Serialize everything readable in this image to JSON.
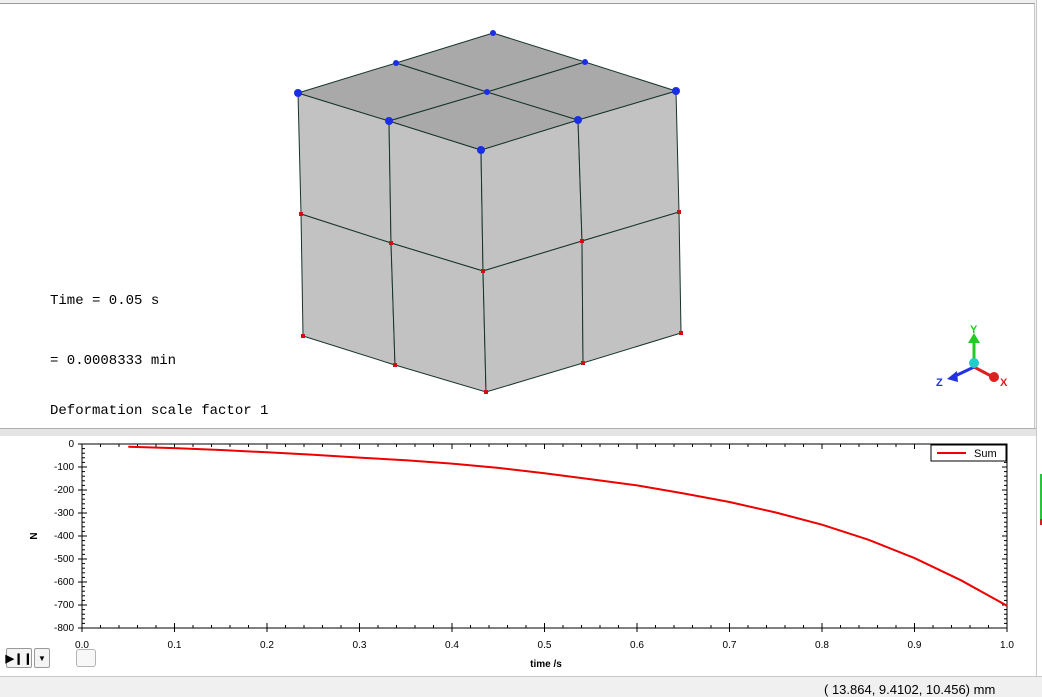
{
  "viewport": {
    "time_line1": "Time = 0.05 s",
    "time_line2": "= 0.0008333 min",
    "deformation_label": "Deformation scale factor 1",
    "axes": {
      "y": "Y",
      "z": "Z",
      "x": "X"
    },
    "colors": {
      "face_top": "#a9a9a9",
      "face_side": "#c2c2c2",
      "node_top": "#1a2ee6",
      "node_side": "#d01010",
      "axis_x": "#dd2020",
      "axis_y": "#22cc22",
      "axis_z": "#2233dd"
    }
  },
  "chart_data": {
    "type": "line",
    "title": "",
    "xlabel": "time /s",
    "ylabel": "N",
    "xlim": [
      0.0,
      1.0
    ],
    "ylim": [
      -800,
      0
    ],
    "xticks": [
      0.0,
      0.1,
      0.2,
      0.3,
      0.4,
      0.5,
      0.6,
      0.7,
      0.8,
      0.9,
      1.0
    ],
    "xtick_labels": [
      "0.0",
      "0.1",
      "0.2",
      "0.3",
      "0.4",
      "0.5",
      "0.6",
      "0.7",
      "0.8",
      "0.9",
      "1.0"
    ],
    "yticks": [
      0,
      -100,
      -200,
      -300,
      -400,
      -500,
      -600,
      -700,
      -800
    ],
    "ytick_labels": [
      "0",
      "-100",
      "-200",
      "-300",
      "-400",
      "-500",
      "-600",
      "-700",
      "-800"
    ],
    "legend": "top-right",
    "grid": false,
    "series": [
      {
        "name": "Sum",
        "color": "#ee0000",
        "x": [
          0.05,
          0.1,
          0.15,
          0.2,
          0.25,
          0.3,
          0.35,
          0.4,
          0.45,
          0.5,
          0.55,
          0.6,
          0.65,
          0.7,
          0.75,
          0.8,
          0.85,
          0.9,
          0.95,
          1.0
        ],
        "y": [
          -12,
          -18,
          -26,
          -36,
          -47,
          -59,
          -71,
          -85,
          -104,
          -127,
          -153,
          -180,
          -215,
          -252,
          -298,
          -351,
          -416,
          -496,
          -592,
          -703
        ]
      }
    ]
  },
  "controls": {
    "play_pause": "▶❙❙",
    "dropdown": "▼"
  },
  "status": {
    "coordinate_readout": "( 13.864, 9.4102, 10.456) mm"
  }
}
